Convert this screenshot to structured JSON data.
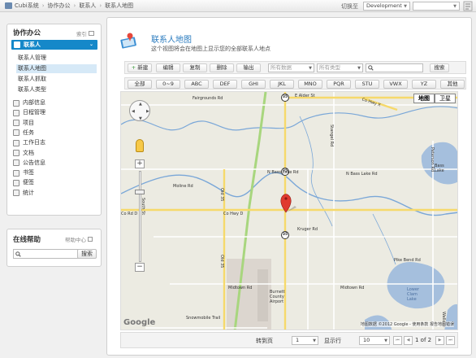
{
  "topbar": {
    "breadcrumb": [
      "Cubi系统",
      "协作办公",
      "联系人",
      "联系人地图"
    ],
    "switch_label": "切换至",
    "env_select": "Development",
    "second_select": ""
  },
  "sidebar": {
    "title": "协作办公",
    "index_label": "索引",
    "contact_header": "联系人",
    "contact_subitems": [
      {
        "label": "联系人管理",
        "active": false
      },
      {
        "label": "联系人地图",
        "active": true
      },
      {
        "label": "联系人抓取",
        "active": false
      },
      {
        "label": "联系人类型",
        "active": false
      }
    ],
    "modules": [
      "内部信息",
      "日程管理",
      "项目",
      "任务",
      "工作日志",
      "文档",
      "公告信息",
      "书签",
      "便签",
      "统计"
    ]
  },
  "help": {
    "title": "在线帮助",
    "center_label": "帮助中心",
    "search_placeholder": "",
    "search_button": "搜索"
  },
  "main": {
    "title": "联系人地图",
    "description": "这个视图将会在地图上显示您的全部联系人地点",
    "toolbar": {
      "new": "新建",
      "edit": "编辑",
      "copy": "复制",
      "delete": "删除",
      "export": "输出",
      "data_select": "所有数据",
      "type_select": "所有类型",
      "search_value": "",
      "search_button": "搜索"
    },
    "alpha_filters": [
      "全部",
      "0~9",
      "ABC",
      "DEF",
      "GHI",
      "JKL",
      "MNO",
      "PQR",
      "STU",
      "VWX",
      "YZ",
      "其他"
    ]
  },
  "map": {
    "type_buttons": {
      "map": "地图",
      "satellite": "卫星"
    },
    "labels": {
      "fairgrounds": "Fairgrounds Rd",
      "elder": "E Alder St",
      "coHwyX": "Co Hwy X",
      "stangel": "Stangel Rd",
      "nbass": "N Bass Lake Rd",
      "nbass2": "N Bass Lake Rd",
      "moline": "Moline Rd",
      "oldst": "Old 35",
      "southst": "South St",
      "cohwyd": "Co Hwy D",
      "cohwyd_left": "Co Rd D",
      "kruger": "Kruger Rd",
      "pikebend": "Pike Bend Rd",
      "midtown": "Midtown Rd",
      "midtown2": "Midtown Rd",
      "snowmobile": "Snowmobile Trail",
      "airport": "Burnett County Airport",
      "basslake": "Bass Lake",
      "lowerclam": "Lower Clam Lake",
      "peterson": "Peterson Rd",
      "oldst2": "Old 35",
      "wallace": "Wallace",
      "shield_35": "35",
      "shield_70": "70"
    },
    "google_logo": "Google",
    "copyright": "地图数据 ©2012 Google - 使用条款  报告地图错误"
  },
  "pager": {
    "goto_label": "转到页",
    "page_value": "1",
    "show_label": "显示行",
    "rows_value": "10",
    "page_info": "1 of 2"
  },
  "colors": {
    "accent": "#1588c9",
    "title_blue": "#2a7bbf",
    "road_yellow": "#f6d96b",
    "river": "#7aa7d8",
    "lake": "#a5bfdd",
    "highway_green": "#a8d67e"
  }
}
